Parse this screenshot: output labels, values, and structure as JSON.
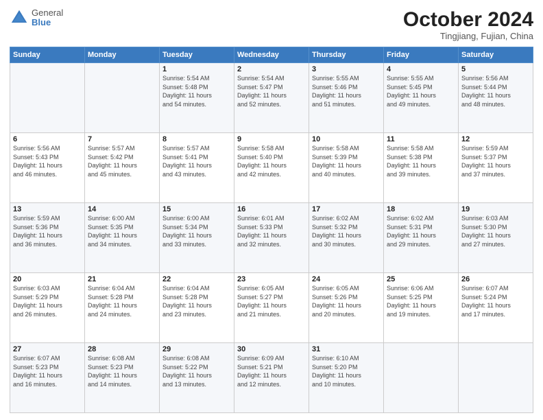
{
  "header": {
    "logo_general": "General",
    "logo_blue": "Blue",
    "month_title": "October 2024",
    "location": "Tingjiang, Fujian, China"
  },
  "weekdays": [
    "Sunday",
    "Monday",
    "Tuesday",
    "Wednesday",
    "Thursday",
    "Friday",
    "Saturday"
  ],
  "weeks": [
    [
      {
        "day": "",
        "info": ""
      },
      {
        "day": "",
        "info": ""
      },
      {
        "day": "1",
        "info": "Sunrise: 5:54 AM\nSunset: 5:48 PM\nDaylight: 11 hours\nand 54 minutes."
      },
      {
        "day": "2",
        "info": "Sunrise: 5:54 AM\nSunset: 5:47 PM\nDaylight: 11 hours\nand 52 minutes."
      },
      {
        "day": "3",
        "info": "Sunrise: 5:55 AM\nSunset: 5:46 PM\nDaylight: 11 hours\nand 51 minutes."
      },
      {
        "day": "4",
        "info": "Sunrise: 5:55 AM\nSunset: 5:45 PM\nDaylight: 11 hours\nand 49 minutes."
      },
      {
        "day": "5",
        "info": "Sunrise: 5:56 AM\nSunset: 5:44 PM\nDaylight: 11 hours\nand 48 minutes."
      }
    ],
    [
      {
        "day": "6",
        "info": "Sunrise: 5:56 AM\nSunset: 5:43 PM\nDaylight: 11 hours\nand 46 minutes."
      },
      {
        "day": "7",
        "info": "Sunrise: 5:57 AM\nSunset: 5:42 PM\nDaylight: 11 hours\nand 45 minutes."
      },
      {
        "day": "8",
        "info": "Sunrise: 5:57 AM\nSunset: 5:41 PM\nDaylight: 11 hours\nand 43 minutes."
      },
      {
        "day": "9",
        "info": "Sunrise: 5:58 AM\nSunset: 5:40 PM\nDaylight: 11 hours\nand 42 minutes."
      },
      {
        "day": "10",
        "info": "Sunrise: 5:58 AM\nSunset: 5:39 PM\nDaylight: 11 hours\nand 40 minutes."
      },
      {
        "day": "11",
        "info": "Sunrise: 5:58 AM\nSunset: 5:38 PM\nDaylight: 11 hours\nand 39 minutes."
      },
      {
        "day": "12",
        "info": "Sunrise: 5:59 AM\nSunset: 5:37 PM\nDaylight: 11 hours\nand 37 minutes."
      }
    ],
    [
      {
        "day": "13",
        "info": "Sunrise: 5:59 AM\nSunset: 5:36 PM\nDaylight: 11 hours\nand 36 minutes."
      },
      {
        "day": "14",
        "info": "Sunrise: 6:00 AM\nSunset: 5:35 PM\nDaylight: 11 hours\nand 34 minutes."
      },
      {
        "day": "15",
        "info": "Sunrise: 6:00 AM\nSunset: 5:34 PM\nDaylight: 11 hours\nand 33 minutes."
      },
      {
        "day": "16",
        "info": "Sunrise: 6:01 AM\nSunset: 5:33 PM\nDaylight: 11 hours\nand 32 minutes."
      },
      {
        "day": "17",
        "info": "Sunrise: 6:02 AM\nSunset: 5:32 PM\nDaylight: 11 hours\nand 30 minutes."
      },
      {
        "day": "18",
        "info": "Sunrise: 6:02 AM\nSunset: 5:31 PM\nDaylight: 11 hours\nand 29 minutes."
      },
      {
        "day": "19",
        "info": "Sunrise: 6:03 AM\nSunset: 5:30 PM\nDaylight: 11 hours\nand 27 minutes."
      }
    ],
    [
      {
        "day": "20",
        "info": "Sunrise: 6:03 AM\nSunset: 5:29 PM\nDaylight: 11 hours\nand 26 minutes."
      },
      {
        "day": "21",
        "info": "Sunrise: 6:04 AM\nSunset: 5:28 PM\nDaylight: 11 hours\nand 24 minutes."
      },
      {
        "day": "22",
        "info": "Sunrise: 6:04 AM\nSunset: 5:28 PM\nDaylight: 11 hours\nand 23 minutes."
      },
      {
        "day": "23",
        "info": "Sunrise: 6:05 AM\nSunset: 5:27 PM\nDaylight: 11 hours\nand 21 minutes."
      },
      {
        "day": "24",
        "info": "Sunrise: 6:05 AM\nSunset: 5:26 PM\nDaylight: 11 hours\nand 20 minutes."
      },
      {
        "day": "25",
        "info": "Sunrise: 6:06 AM\nSunset: 5:25 PM\nDaylight: 11 hours\nand 19 minutes."
      },
      {
        "day": "26",
        "info": "Sunrise: 6:07 AM\nSunset: 5:24 PM\nDaylight: 11 hours\nand 17 minutes."
      }
    ],
    [
      {
        "day": "27",
        "info": "Sunrise: 6:07 AM\nSunset: 5:23 PM\nDaylight: 11 hours\nand 16 minutes."
      },
      {
        "day": "28",
        "info": "Sunrise: 6:08 AM\nSunset: 5:23 PM\nDaylight: 11 hours\nand 14 minutes."
      },
      {
        "day": "29",
        "info": "Sunrise: 6:08 AM\nSunset: 5:22 PM\nDaylight: 11 hours\nand 13 minutes."
      },
      {
        "day": "30",
        "info": "Sunrise: 6:09 AM\nSunset: 5:21 PM\nDaylight: 11 hours\nand 12 minutes."
      },
      {
        "day": "31",
        "info": "Sunrise: 6:10 AM\nSunset: 5:20 PM\nDaylight: 11 hours\nand 10 minutes."
      },
      {
        "day": "",
        "info": ""
      },
      {
        "day": "",
        "info": ""
      }
    ]
  ]
}
